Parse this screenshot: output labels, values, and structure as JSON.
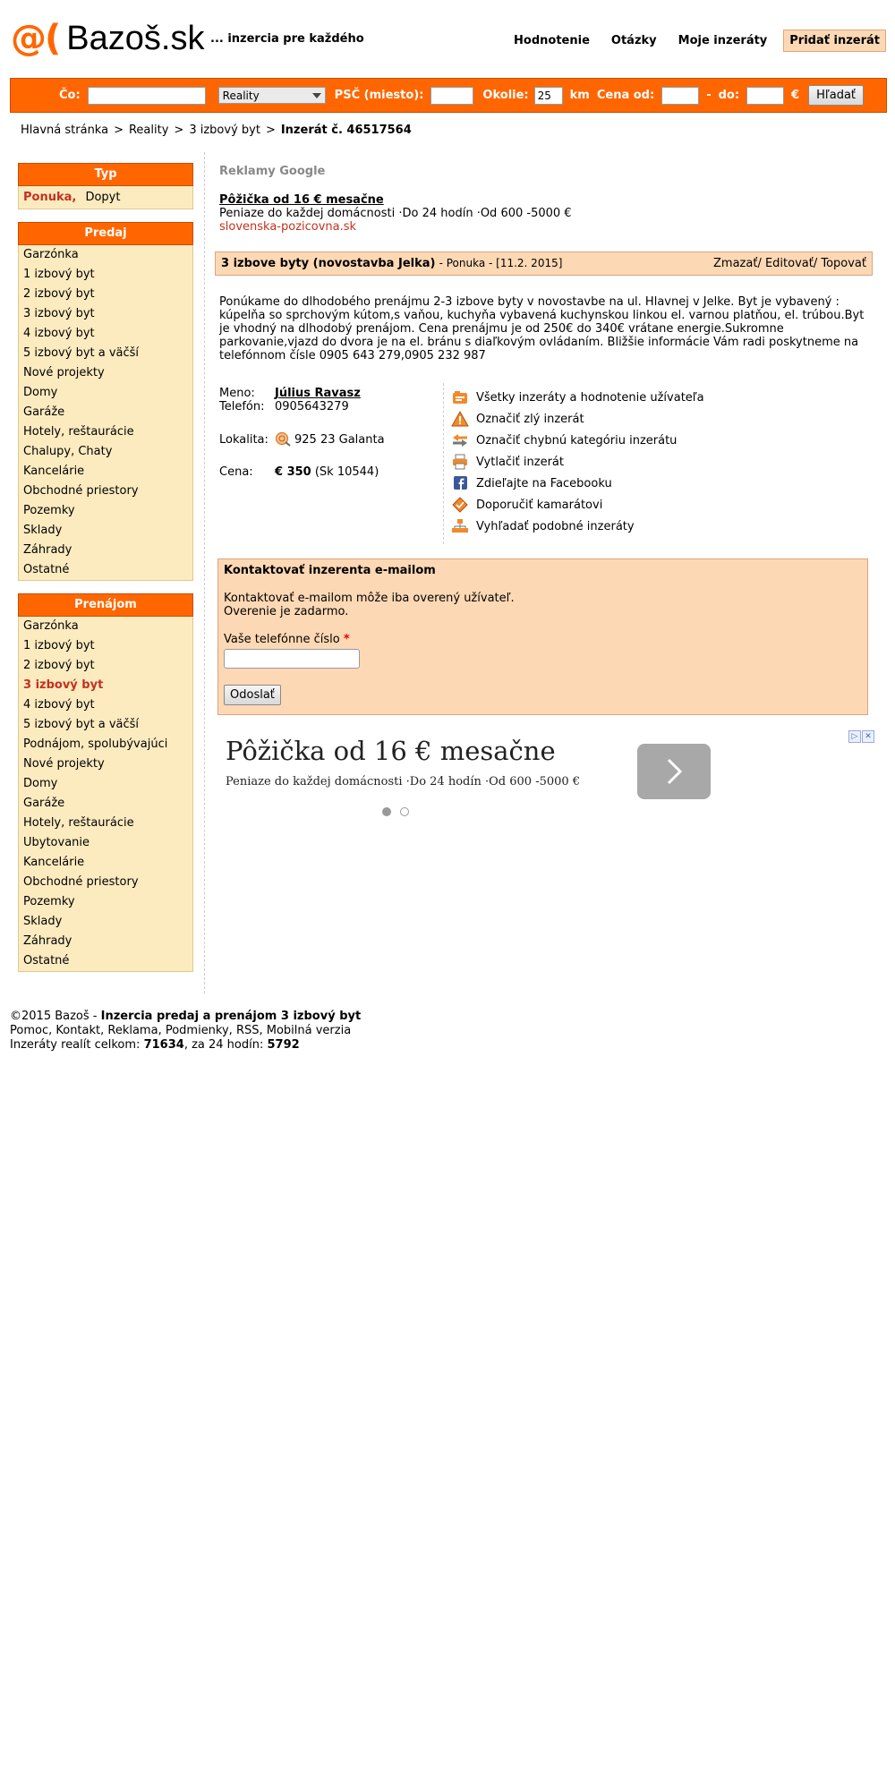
{
  "header": {
    "logo_symbol": "@(",
    "logo_text": "Bazoš.sk",
    "tagline": "... inzercia pre každého",
    "nav": [
      "Hodnotenie",
      "Otázky",
      "Moje inzeráty"
    ],
    "add_button": "Pridať inzerát"
  },
  "search": {
    "co_label": "Čo:",
    "co_value": "",
    "category_selected": "Reality",
    "psc_label": "PSČ (miesto):",
    "psc_value": "",
    "okolie_label": "Okolie:",
    "okolie_value": "25",
    "km_label": "km",
    "cena_od_label": "Cena od:",
    "cena_od_value": "",
    "dash": "-",
    "do_label": "do:",
    "cena_do_value": "",
    "currency": "€",
    "button": "Hľadať"
  },
  "breadcrumb": {
    "items": [
      "Hlavná stránka",
      "Reality",
      "3 izbový byt"
    ],
    "separator": ">",
    "current": "Inzerát č. 46517564"
  },
  "sidebar": {
    "typ": {
      "title": "Typ",
      "ponuka": "Ponuka,",
      "dopyt": "Dopyt"
    },
    "predaj": {
      "title": "Predaj",
      "items": [
        "Garzónka",
        "1 izbový byt",
        "2 izbový byt",
        "3 izbový byt",
        "4 izbový byt",
        "5 izbový byt a väčší",
        "Nové projekty",
        "Domy",
        "Garáže",
        "Hotely, reštaurácie",
        "Chalupy, Chaty",
        "Kancelárie",
        "Obchodné priestory",
        "Pozemky",
        "Sklady",
        "Záhrady",
        "Ostatné"
      ]
    },
    "prenajom": {
      "title": "Prenájom",
      "items": [
        "Garzónka",
        "1 izbový byt",
        "2 izbový byt",
        "3 izbový byt",
        "4 izbový byt",
        "5 izbový byt a väčší",
        "Podnájom, spolubývajúci",
        "Nové projekty",
        "Domy",
        "Garáže",
        "Hotely, reštaurácie",
        "Ubytovanie",
        "Kancelárie",
        "Obchodné priestory",
        "Pozemky",
        "Sklady",
        "Záhrady",
        "Ostatné"
      ]
    }
  },
  "ads": {
    "label": "Reklamy Google",
    "ad1": {
      "title": "Pôžička od 16 € mesačne",
      "text": "Peniaze do každej domácnosti ·Do 24 hodín ·Od 600 -5000 €",
      "url": "slovenska-pozicovna.sk"
    },
    "ad2": {
      "title": "Pôžička od 16 € mesačne",
      "text": "Peniaze do každej domácnosti ·Do 24 hodín ·Od 600 -5000 €"
    }
  },
  "listing": {
    "title": "3 izbove byty (novostavba Jelka)",
    "meta": "- Ponuka - [11.2. 2015]",
    "actions": "Zmazať/ Editovať/ Topovať",
    "description": "Ponúkame do dlhodobého prenájmu 2-3 izbove byty v novostavbe na ul. Hlavnej v Jelke. Byt je vybavený : kúpelňa so sprchovým kútom,s vaňou, kuchyňa vybavená kuchynskou linkou el. varnou platňou, el. trúbou.Byt je vhodný na dlhodobý prenájom. Cena prenájmu je od 250€ do 340€ vrátane energie.Sukromne parkovanie,vjazd do dvora je na el. bránu s diaľkovým ovládaním. Bližšie informácie Vám radi poskytneme na telefónnom čísle 0905 643 279,0905 232 987",
    "meno_label": "Meno:",
    "meno_value": "Július Ravasz",
    "telefon_label": "Telefón:",
    "telefon_value": "0905643279",
    "lokalita_label": "Lokalita:",
    "lokalita_value": "925 23 Galanta",
    "cena_label": "Cena:",
    "cena_value": "€ 350",
    "cena_sk": "(Sk 10544)"
  },
  "actions": [
    "Všetky inzeráty a hodnotenie užívateľa",
    "Označiť zlý inzerát",
    "Označiť chybnú kategóriu inzerátu",
    "Vytlačiť inzerát",
    "Zdieľajte na Facebooku",
    "Doporučiť kamarátovi",
    "Vyhľadať podobné inzeráty"
  ],
  "contact": {
    "title": "Kontaktovať inzerenta e-mailom",
    "line1": "Kontaktovať e-mailom môže iba overený užívateľ.",
    "line2": "Overenie je zadarmo.",
    "phone_label": "Vaše telefónne číslo",
    "required": "*",
    "send": "Odoslať"
  },
  "footer": {
    "copyright": "©2015 Bazoš -",
    "tagline": "Inzercia predaj a prenájom 3 izbový byt",
    "links": "Pomoc, Kontakt, Reklama, Podmienky, RSS, Mobilná verzia",
    "stats_label": "Inzeráty realít celkom:",
    "stats_total": "71634",
    "stats_24_label": ", za 24 hodín:",
    "stats_24": "5792"
  }
}
